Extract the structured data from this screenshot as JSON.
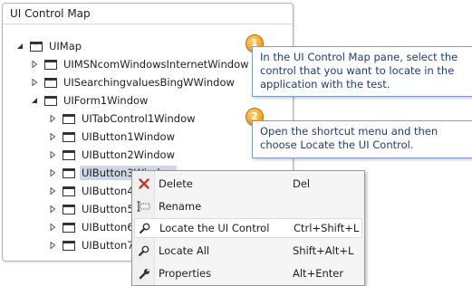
{
  "panel": {
    "title": "UI Control Map",
    "tree": [
      {
        "label": "UIMap",
        "expanded": true
      },
      {
        "label": "UIMSNcomWindowsInternetWindow",
        "expanded": false
      },
      {
        "label": "UISearchingvaluesBingWWindow",
        "expanded": false
      },
      {
        "label": "UIForm1Window",
        "expanded": true
      },
      {
        "label": "UITabControl1Window",
        "expanded": false
      },
      {
        "label": "UIButton1Window",
        "expanded": false
      },
      {
        "label": "UIButton2Window",
        "expanded": false
      },
      {
        "label": "UIButton3Window",
        "expanded": false,
        "selected": true
      },
      {
        "label": "UIButton4...",
        "expanded": false
      },
      {
        "label": "UIButton5...",
        "expanded": false
      },
      {
        "label": "UIButton6...",
        "expanded": false
      },
      {
        "label": "UIButton7...",
        "expanded": false
      }
    ]
  },
  "callouts": [
    {
      "number": "1",
      "text": "In the UI Control Map pane, select the control that you want to locate in the application with the test."
    },
    {
      "number": "2",
      "text": "Open the shortcut menu and then choose Locate the UI Control."
    }
  ],
  "context_menu": {
    "items": [
      {
        "label": "Delete",
        "shortcut": "Del",
        "icon": "delete-x-icon"
      },
      {
        "label": "Rename",
        "shortcut": "",
        "icon": "rename-icon"
      },
      {
        "label": "Locate the UI Control",
        "shortcut": "Ctrl+Shift+L",
        "icon": "locate-magnifier-icon",
        "highlighted": true
      },
      {
        "label": "Locate All",
        "shortcut": "Shift+Alt+L",
        "icon": "locate-all-magnifier-icon"
      },
      {
        "label": "Properties",
        "shortcut": "Alt+Enter",
        "icon": "wrench-icon"
      }
    ]
  },
  "colors": {
    "callout_text": "#1f3b7a",
    "callout_border": "#7d9bd0",
    "badge": "#f5a623",
    "selection": "#cfd6e6",
    "delete_icon": "#c0392b"
  }
}
